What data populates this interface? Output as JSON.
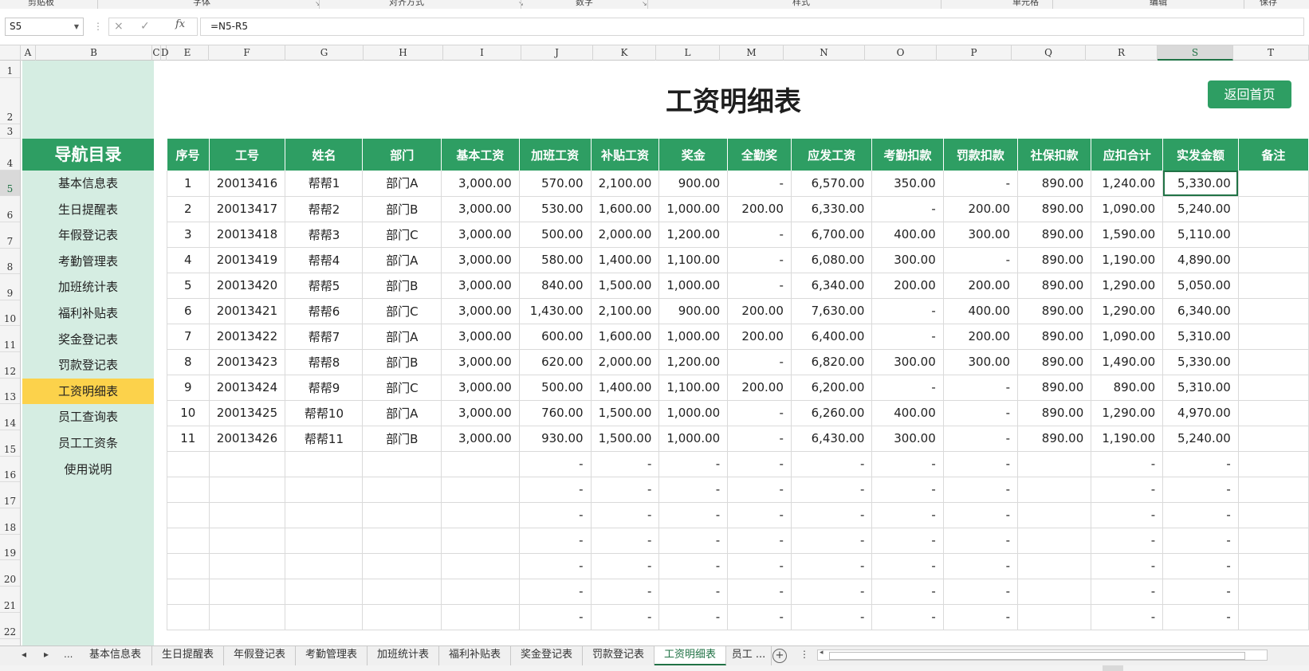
{
  "ribbon": {
    "groups": [
      "剪贴板",
      "字体",
      "对齐方式",
      "数字",
      "样式",
      "单元格",
      "编辑",
      "保存"
    ]
  },
  "formula_bar": {
    "name_box": "S5",
    "formula": "=N5-R5",
    "fx_label": "fx",
    "cancel_icon": "×",
    "enter_icon": "✓"
  },
  "columns": [
    "A",
    "B",
    "C",
    "D",
    "E",
    "F",
    "G",
    "H",
    "I",
    "J",
    "K",
    "L",
    "M",
    "N",
    "O",
    "P",
    "Q",
    "R",
    "S",
    "T"
  ],
  "rows": [
    "1",
    "2",
    "3",
    "4",
    "5",
    "6",
    "7",
    "8",
    "9",
    "10",
    "11",
    "12",
    "13",
    "14",
    "15",
    "16",
    "17",
    "18",
    "19",
    "20",
    "21",
    "22"
  ],
  "selected_cell": "S5",
  "nav": {
    "title": "导航目录",
    "items": [
      {
        "label": "基本信息表",
        "active": false
      },
      {
        "label": "生日提醒表",
        "active": false
      },
      {
        "label": "年假登记表",
        "active": false
      },
      {
        "label": "考勤管理表",
        "active": false
      },
      {
        "label": "加班统计表",
        "active": false
      },
      {
        "label": "福利补贴表",
        "active": false
      },
      {
        "label": "奖金登记表",
        "active": false
      },
      {
        "label": "罚款登记表",
        "active": false
      },
      {
        "label": "工资明细表",
        "active": true
      },
      {
        "label": "员工查询表",
        "active": false
      },
      {
        "label": "员工工资条",
        "active": false
      },
      {
        "label": "使用说明",
        "active": false
      }
    ]
  },
  "sheet": {
    "title": "工资明细表",
    "home_button": "返回首页"
  },
  "table": {
    "headers": [
      "序号",
      "工号",
      "姓名",
      "部门",
      "基本工资",
      "加班工资",
      "补贴工资",
      "奖金",
      "全勤奖",
      "应发工资",
      "考勤扣款",
      "罚款扣款",
      "社保扣款",
      "应扣合计",
      "实发金额",
      "备注"
    ],
    "rows": [
      [
        "1",
        "20013416",
        "帮帮1",
        "部门A",
        "3,000.00",
        "570.00",
        "2,100.00",
        "900.00",
        "-",
        "6,570.00",
        "350.00",
        "-",
        "890.00",
        "1,240.00",
        "5,330.00",
        ""
      ],
      [
        "2",
        "20013417",
        "帮帮2",
        "部门B",
        "3,000.00",
        "530.00",
        "1,600.00",
        "1,000.00",
        "200.00",
        "6,330.00",
        "-",
        "200.00",
        "890.00",
        "1,090.00",
        "5,240.00",
        ""
      ],
      [
        "3",
        "20013418",
        "帮帮3",
        "部门C",
        "3,000.00",
        "500.00",
        "2,000.00",
        "1,200.00",
        "-",
        "6,700.00",
        "400.00",
        "300.00",
        "890.00",
        "1,590.00",
        "5,110.00",
        ""
      ],
      [
        "4",
        "20013419",
        "帮帮4",
        "部门A",
        "3,000.00",
        "580.00",
        "1,400.00",
        "1,100.00",
        "-",
        "6,080.00",
        "300.00",
        "-",
        "890.00",
        "1,190.00",
        "4,890.00",
        ""
      ],
      [
        "5",
        "20013420",
        "帮帮5",
        "部门B",
        "3,000.00",
        "840.00",
        "1,500.00",
        "1,000.00",
        "-",
        "6,340.00",
        "200.00",
        "200.00",
        "890.00",
        "1,290.00",
        "5,050.00",
        ""
      ],
      [
        "6",
        "20013421",
        "帮帮6",
        "部门C",
        "3,000.00",
        "1,430.00",
        "2,100.00",
        "900.00",
        "200.00",
        "7,630.00",
        "-",
        "400.00",
        "890.00",
        "1,290.00",
        "6,340.00",
        ""
      ],
      [
        "7",
        "20013422",
        "帮帮7",
        "部门A",
        "3,000.00",
        "600.00",
        "1,600.00",
        "1,000.00",
        "200.00",
        "6,400.00",
        "-",
        "200.00",
        "890.00",
        "1,090.00",
        "5,310.00",
        ""
      ],
      [
        "8",
        "20013423",
        "帮帮8",
        "部门B",
        "3,000.00",
        "620.00",
        "2,000.00",
        "1,200.00",
        "-",
        "6,820.00",
        "300.00",
        "300.00",
        "890.00",
        "1,490.00",
        "5,330.00",
        ""
      ],
      [
        "9",
        "20013424",
        "帮帮9",
        "部门C",
        "3,000.00",
        "500.00",
        "1,400.00",
        "1,100.00",
        "200.00",
        "6,200.00",
        "-",
        "-",
        "890.00",
        "890.00",
        "5,310.00",
        ""
      ],
      [
        "10",
        "20013425",
        "帮帮10",
        "部门A",
        "3,000.00",
        "760.00",
        "1,500.00",
        "1,000.00",
        "-",
        "6,260.00",
        "400.00",
        "-",
        "890.00",
        "1,290.00",
        "4,970.00",
        ""
      ],
      [
        "11",
        "20013426",
        "帮帮11",
        "部门B",
        "3,000.00",
        "930.00",
        "1,500.00",
        "1,000.00",
        "-",
        "6,430.00",
        "300.00",
        "-",
        "890.00",
        "1,190.00",
        "5,240.00",
        ""
      ],
      [
        "",
        "",
        "",
        "",
        "",
        "-",
        "-",
        "-",
        "-",
        "-",
        "-",
        "-",
        "",
        "-",
        "-",
        ""
      ],
      [
        "",
        "",
        "",
        "",
        "",
        "-",
        "-",
        "-",
        "-",
        "-",
        "-",
        "-",
        "",
        "-",
        "-",
        ""
      ],
      [
        "",
        "",
        "",
        "",
        "",
        "-",
        "-",
        "-",
        "-",
        "-",
        "-",
        "-",
        "",
        "-",
        "-",
        ""
      ],
      [
        "",
        "",
        "",
        "",
        "",
        "-",
        "-",
        "-",
        "-",
        "-",
        "-",
        "-",
        "",
        "-",
        "-",
        ""
      ],
      [
        "",
        "",
        "",
        "",
        "",
        "-",
        "-",
        "-",
        "-",
        "-",
        "-",
        "-",
        "",
        "-",
        "-",
        ""
      ],
      [
        "",
        "",
        "",
        "",
        "",
        "-",
        "-",
        "-",
        "-",
        "-",
        "-",
        "-",
        "",
        "-",
        "-",
        ""
      ],
      [
        "",
        "",
        "",
        "",
        "",
        "-",
        "-",
        "-",
        "-",
        "-",
        "-",
        "-",
        "",
        "-",
        "-",
        ""
      ]
    ]
  },
  "tabs": {
    "prev": "◂",
    "next": "▸",
    "more": "...",
    "items": [
      {
        "label": "基本信息表",
        "active": false
      },
      {
        "label": "生日提醒表",
        "active": false
      },
      {
        "label": "年假登记表",
        "active": false
      },
      {
        "label": "考勤管理表",
        "active": false
      },
      {
        "label": "加班统计表",
        "active": false
      },
      {
        "label": "福利补贴表",
        "active": false
      },
      {
        "label": "奖金登记表",
        "active": false
      },
      {
        "label": "罚款登记表",
        "active": false
      },
      {
        "label": "工资明细表",
        "active": true
      },
      {
        "label": "员工 ...",
        "active": false
      }
    ],
    "add": "+",
    "more_menu": "⋮"
  },
  "colors": {
    "accent": "#2e9e63",
    "nav_bg": "#d5ede2",
    "active_nav": "#fcd24b",
    "selection": "#217346"
  }
}
